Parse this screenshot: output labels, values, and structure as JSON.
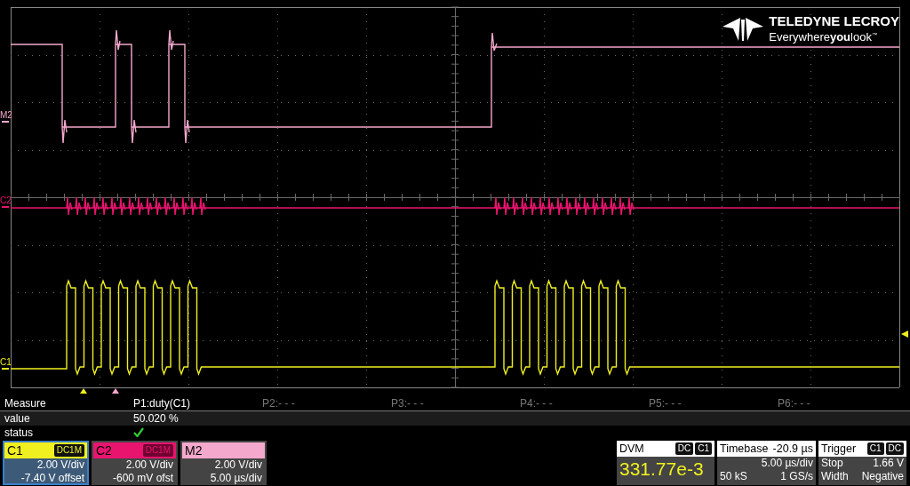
{
  "logo": {
    "name": "TELEDYNE LECROY",
    "tagline": "Everywhere**you**look$^{™}$"
  },
  "traces": [
    {
      "label": "M2",
      "color": "#f4a8cc"
    },
    {
      "label": "C2",
      "color": "#e8146e"
    },
    {
      "label": "C1",
      "color": "#f0f020"
    }
  ],
  "measure": {
    "title": "Measure",
    "value_label": "value",
    "status_label": "status",
    "params": [
      {
        "label": "P1:duty(C1)",
        "enabled": true,
        "value": "50.020 %",
        "status_ok": true
      },
      {
        "label": "P2:- - -",
        "enabled": false
      },
      {
        "label": "P3:- - -",
        "enabled": false
      },
      {
        "label": "P4:- - -",
        "enabled": false
      },
      {
        "label": "P5:- - -",
        "enabled": false
      },
      {
        "label": "P6:- - -",
        "enabled": false
      }
    ]
  },
  "channels": [
    {
      "name": "C1",
      "coupling": "DC1M",
      "color": "#f0f020",
      "selected": true,
      "lines": [
        "2.00 V/div",
        "-7.40 V offset"
      ]
    },
    {
      "name": "C2",
      "coupling": "DC1M",
      "color": "#e8146e",
      "selected": false,
      "lines": [
        "2.00 V/div",
        "-600 mV ofst"
      ]
    },
    {
      "name": "M2",
      "color": "#f4a8cc",
      "selected": false,
      "lines": [
        "2.00 V/div",
        "5.00 µs/div"
      ]
    }
  ],
  "dvm": {
    "title": "DVM",
    "badges": [
      "DC",
      "C1"
    ],
    "reading": "331.77e-3"
  },
  "timebase": {
    "title": "Timebase",
    "delay": "-20.9 µs",
    "rows": [
      {
        "right": "5.00 µs/div"
      },
      {
        "left": "50 kS",
        "right": "1 GS/s"
      }
    ]
  },
  "trigger": {
    "title": "Trigger",
    "badges": [
      "C1",
      "DC"
    ],
    "rows": [
      {
        "left": "Stop",
        "right": "1.66 V"
      },
      {
        "left": "Width",
        "right": "Negative"
      }
    ]
  }
}
